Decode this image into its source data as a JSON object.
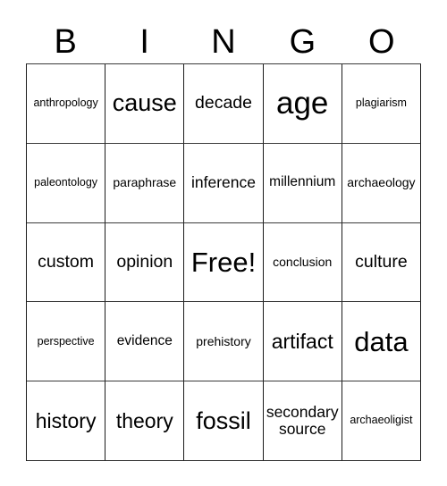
{
  "card": {
    "title_letters": [
      "B",
      "I",
      "N",
      "G",
      "O"
    ],
    "columns": 5,
    "rows": 5,
    "border_color": "#1a1a1a",
    "background_color": "#ffffff",
    "text_color": "#000000",
    "free_space": {
      "row": 2,
      "col": 2,
      "label": "Free!"
    },
    "grid": [
      [
        {
          "label": "anthropology",
          "size": "xs"
        },
        {
          "label": "cause",
          "size": "xl"
        },
        {
          "label": "decade",
          "size": "ml"
        },
        {
          "label": "age",
          "size": "hg"
        },
        {
          "label": "plagiarism",
          "size": "xs"
        }
      ],
      [
        {
          "label": "paleontology",
          "size": "xs"
        },
        {
          "label": "paraphrase",
          "size": "s"
        },
        {
          "label": "inference",
          "size": "m"
        },
        {
          "label": "millennium",
          "size": "sm"
        },
        {
          "label": "archaeology",
          "size": "s"
        }
      ],
      [
        {
          "label": "custom",
          "size": "ml"
        },
        {
          "label": "opinion",
          "size": "ml"
        },
        {
          "label": "Free!",
          "size": "xxl"
        },
        {
          "label": "conclusion",
          "size": "s"
        },
        {
          "label": "culture",
          "size": "ml"
        }
      ],
      [
        {
          "label": "perspective",
          "size": "xs"
        },
        {
          "label": "evidence",
          "size": "sm"
        },
        {
          "label": "prehistory",
          "size": "s"
        },
        {
          "label": "artifact",
          "size": "l"
        },
        {
          "label": "data",
          "size": "xxl"
        }
      ],
      [
        {
          "label": "history",
          "size": "l"
        },
        {
          "label": "theory",
          "size": "l"
        },
        {
          "label": "fossil",
          "size": "xl"
        },
        {
          "label": "secondary source",
          "size": "m"
        },
        {
          "label": "archaeoligist",
          "size": "xs"
        }
      ]
    ]
  }
}
